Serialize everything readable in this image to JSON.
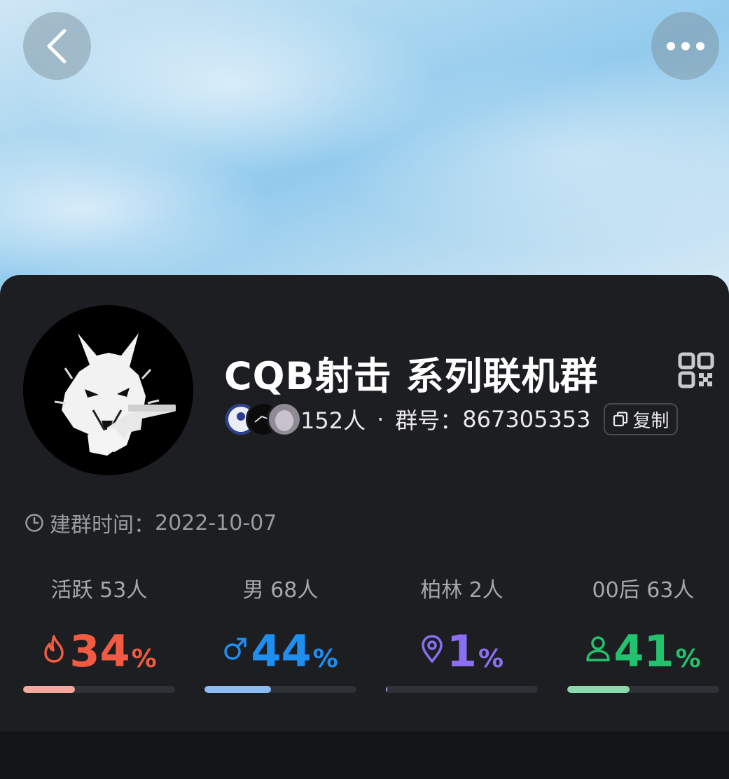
{
  "header": {
    "back_icon": "chevron-left-icon",
    "more_icon": "more-horizontal-icon"
  },
  "group": {
    "name": "CQB射击 系列联机群",
    "member_count": "152人",
    "separator": "·",
    "number_label": "群号：",
    "number": "867305353",
    "copy_label": "复制",
    "created_label": "建群时间：",
    "created_date": "2022-10-07"
  },
  "stats": [
    {
      "label": "活跃 53人",
      "value": "34",
      "pct_sign": "%",
      "icon": "fire-icon",
      "color": "#f35a42",
      "bar_color": "#f7a89e",
      "fraction": 0.34
    },
    {
      "label": "男 68人",
      "value": "44",
      "pct_sign": "%",
      "icon": "male-icon",
      "color": "#1e8ff2",
      "bar_color": "#8bbcf3",
      "fraction": 0.44
    },
    {
      "label": "柏林 2人",
      "value": "1",
      "pct_sign": "%",
      "icon": "location-pin-icon",
      "color": "#8b6ff2",
      "bar_color": "#b3a2f6",
      "fraction": 0.01
    },
    {
      "label": "00后 63人",
      "value": "41",
      "pct_sign": "%",
      "icon": "person-icon",
      "color": "#23c26e",
      "bar_color": "#8cd9ae",
      "fraction": 0.41
    }
  ],
  "colors": {
    "card_bg": "#1d1e21",
    "page_bg": "#131417"
  }
}
